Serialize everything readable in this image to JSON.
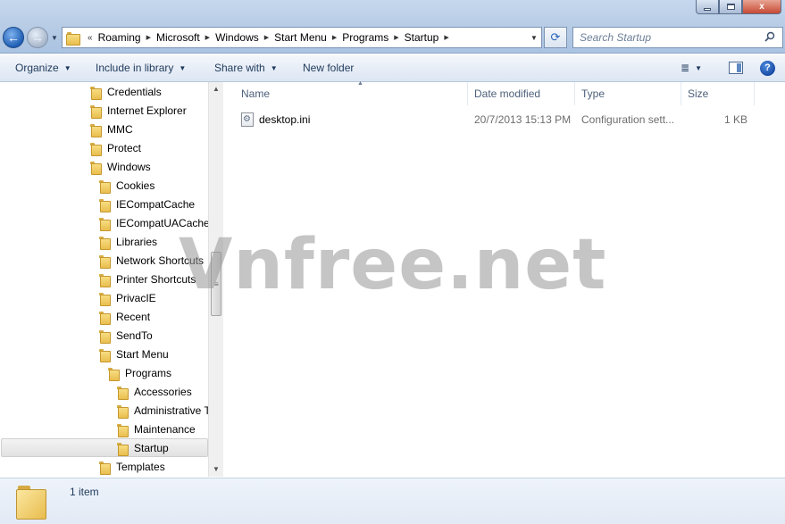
{
  "window": {
    "min_glyph": "",
    "max_glyph": "",
    "close_glyph": "x"
  },
  "nav": {
    "back_glyph": "←",
    "forward_glyph": "→",
    "history_glyph": "▼"
  },
  "address": {
    "overflow_glyph": "«",
    "crumbs": [
      "Roaming",
      "Microsoft",
      "Windows",
      "Start Menu",
      "Programs",
      "Startup"
    ],
    "separator": "▶",
    "dropdown_glyph": "▼",
    "refresh_glyph": "⟳"
  },
  "search": {
    "placeholder": "Search Startup",
    "icon": "search-icon"
  },
  "toolbar": {
    "organize": "Organize",
    "include_in_library": "Include in library",
    "share_with": "Share with",
    "new_folder": "New folder",
    "caret": "▼",
    "views_glyph": "≣",
    "help_glyph": "?"
  },
  "tree": {
    "items": [
      {
        "label": "Credentials",
        "level": 0
      },
      {
        "label": "Internet Explorer",
        "level": 0
      },
      {
        "label": "MMC",
        "level": 0
      },
      {
        "label": "Protect",
        "level": 0
      },
      {
        "label": "Windows",
        "level": 0
      },
      {
        "label": "Cookies",
        "level": 1
      },
      {
        "label": "IECompatCache",
        "level": 1
      },
      {
        "label": "IECompatUACache",
        "level": 1
      },
      {
        "label": "Libraries",
        "level": 1
      },
      {
        "label": "Network Shortcuts",
        "level": 1
      },
      {
        "label": "Printer Shortcuts",
        "level": 1
      },
      {
        "label": "PrivacIE",
        "level": 1
      },
      {
        "label": "Recent",
        "level": 1
      },
      {
        "label": "SendTo",
        "level": 1
      },
      {
        "label": "Start Menu",
        "level": 1
      },
      {
        "label": "Programs",
        "level": 2
      },
      {
        "label": "Accessories",
        "level": 3
      },
      {
        "label": "Administrative T",
        "level": 3
      },
      {
        "label": "Maintenance",
        "level": 3
      },
      {
        "label": "Startup",
        "level": 3,
        "selected": true
      },
      {
        "label": "Templates",
        "level": 1
      }
    ],
    "scroll_up": "▲",
    "scroll_down": "▼",
    "grip": "≡"
  },
  "columns": {
    "name": "Name",
    "date_modified": "Date modified",
    "type": "Type",
    "size": "Size",
    "sort_glyph": "▲"
  },
  "files": [
    {
      "name": "desktop.ini",
      "date_modified": "20/7/2013 15:13 PM",
      "type": "Configuration sett...",
      "size": "1 KB"
    }
  ],
  "watermark": "Vnfree.net",
  "details": {
    "item_count": "1 item"
  }
}
